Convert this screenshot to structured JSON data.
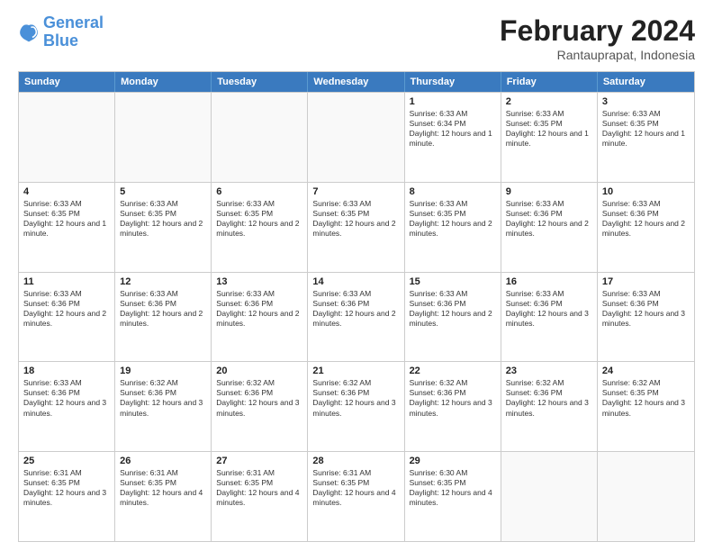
{
  "logo": {
    "line1": "General",
    "line2": "Blue"
  },
  "header": {
    "title": "February 2024",
    "subtitle": "Rantauprapat, Indonesia"
  },
  "weekdays": [
    "Sunday",
    "Monday",
    "Tuesday",
    "Wednesday",
    "Thursday",
    "Friday",
    "Saturday"
  ],
  "rows": [
    [
      {
        "day": "",
        "text": ""
      },
      {
        "day": "",
        "text": ""
      },
      {
        "day": "",
        "text": ""
      },
      {
        "day": "",
        "text": ""
      },
      {
        "day": "1",
        "text": "Sunrise: 6:33 AM\nSunset: 6:34 PM\nDaylight: 12 hours and 1 minute."
      },
      {
        "day": "2",
        "text": "Sunrise: 6:33 AM\nSunset: 6:35 PM\nDaylight: 12 hours and 1 minute."
      },
      {
        "day": "3",
        "text": "Sunrise: 6:33 AM\nSunset: 6:35 PM\nDaylight: 12 hours and 1 minute."
      }
    ],
    [
      {
        "day": "4",
        "text": "Sunrise: 6:33 AM\nSunset: 6:35 PM\nDaylight: 12 hours and 1 minute."
      },
      {
        "day": "5",
        "text": "Sunrise: 6:33 AM\nSunset: 6:35 PM\nDaylight: 12 hours and 2 minutes."
      },
      {
        "day": "6",
        "text": "Sunrise: 6:33 AM\nSunset: 6:35 PM\nDaylight: 12 hours and 2 minutes."
      },
      {
        "day": "7",
        "text": "Sunrise: 6:33 AM\nSunset: 6:35 PM\nDaylight: 12 hours and 2 minutes."
      },
      {
        "day": "8",
        "text": "Sunrise: 6:33 AM\nSunset: 6:35 PM\nDaylight: 12 hours and 2 minutes."
      },
      {
        "day": "9",
        "text": "Sunrise: 6:33 AM\nSunset: 6:36 PM\nDaylight: 12 hours and 2 minutes."
      },
      {
        "day": "10",
        "text": "Sunrise: 6:33 AM\nSunset: 6:36 PM\nDaylight: 12 hours and 2 minutes."
      }
    ],
    [
      {
        "day": "11",
        "text": "Sunrise: 6:33 AM\nSunset: 6:36 PM\nDaylight: 12 hours and 2 minutes."
      },
      {
        "day": "12",
        "text": "Sunrise: 6:33 AM\nSunset: 6:36 PM\nDaylight: 12 hours and 2 minutes."
      },
      {
        "day": "13",
        "text": "Sunrise: 6:33 AM\nSunset: 6:36 PM\nDaylight: 12 hours and 2 minutes."
      },
      {
        "day": "14",
        "text": "Sunrise: 6:33 AM\nSunset: 6:36 PM\nDaylight: 12 hours and 2 minutes."
      },
      {
        "day": "15",
        "text": "Sunrise: 6:33 AM\nSunset: 6:36 PM\nDaylight: 12 hours and 2 minutes."
      },
      {
        "day": "16",
        "text": "Sunrise: 6:33 AM\nSunset: 6:36 PM\nDaylight: 12 hours and 3 minutes."
      },
      {
        "day": "17",
        "text": "Sunrise: 6:33 AM\nSunset: 6:36 PM\nDaylight: 12 hours and 3 minutes."
      }
    ],
    [
      {
        "day": "18",
        "text": "Sunrise: 6:33 AM\nSunset: 6:36 PM\nDaylight: 12 hours and 3 minutes."
      },
      {
        "day": "19",
        "text": "Sunrise: 6:32 AM\nSunset: 6:36 PM\nDaylight: 12 hours and 3 minutes."
      },
      {
        "day": "20",
        "text": "Sunrise: 6:32 AM\nSunset: 6:36 PM\nDaylight: 12 hours and 3 minutes."
      },
      {
        "day": "21",
        "text": "Sunrise: 6:32 AM\nSunset: 6:36 PM\nDaylight: 12 hours and 3 minutes."
      },
      {
        "day": "22",
        "text": "Sunrise: 6:32 AM\nSunset: 6:36 PM\nDaylight: 12 hours and 3 minutes."
      },
      {
        "day": "23",
        "text": "Sunrise: 6:32 AM\nSunset: 6:36 PM\nDaylight: 12 hours and 3 minutes."
      },
      {
        "day": "24",
        "text": "Sunrise: 6:32 AM\nSunset: 6:35 PM\nDaylight: 12 hours and 3 minutes."
      }
    ],
    [
      {
        "day": "25",
        "text": "Sunrise: 6:31 AM\nSunset: 6:35 PM\nDaylight: 12 hours and 3 minutes."
      },
      {
        "day": "26",
        "text": "Sunrise: 6:31 AM\nSunset: 6:35 PM\nDaylight: 12 hours and 4 minutes."
      },
      {
        "day": "27",
        "text": "Sunrise: 6:31 AM\nSunset: 6:35 PM\nDaylight: 12 hours and 4 minutes."
      },
      {
        "day": "28",
        "text": "Sunrise: 6:31 AM\nSunset: 6:35 PM\nDaylight: 12 hours and 4 minutes."
      },
      {
        "day": "29",
        "text": "Sunrise: 6:30 AM\nSunset: 6:35 PM\nDaylight: 12 hours and 4 minutes."
      },
      {
        "day": "",
        "text": ""
      },
      {
        "day": "",
        "text": ""
      }
    ]
  ]
}
